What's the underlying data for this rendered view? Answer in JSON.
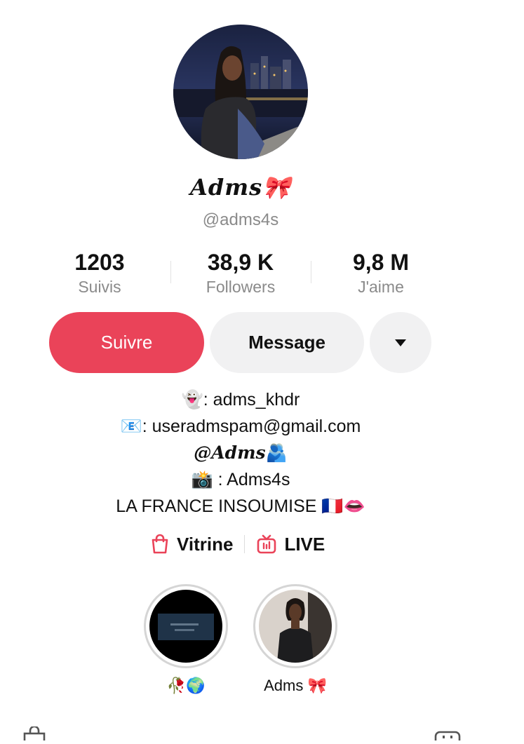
{
  "profile": {
    "display_name": "Adms🎀",
    "handle": "@adms4s"
  },
  "stats": [
    {
      "value": "1203",
      "label": "Suivis"
    },
    {
      "value": "38,9 K",
      "label": "Followers"
    },
    {
      "value": "9,8 M",
      "label": "J'aime"
    }
  ],
  "actions": {
    "follow_label": "Suivre",
    "message_label": "Message"
  },
  "bio": {
    "line1_emoji": "👻",
    "line1_text": ": adms_khdr",
    "line2_emoji": "📧",
    "line2_text": ": useradmspam@gmail.com",
    "line3_text": "@Adms",
    "line3_emoji": "🫂",
    "line4_emoji": "📸",
    "line4_text": " : Adms4s",
    "line5_text": "LA FRANCE INSOUMISE ",
    "line5_emoji": "🇫🇷👄"
  },
  "links": {
    "showcase_label": "Vitrine",
    "live_label": "LIVE"
  },
  "highlights": [
    {
      "label": "🥀🌍"
    },
    {
      "label": "Adms 🎀"
    }
  ],
  "colors": {
    "accent": "#ea4359",
    "secondary_button": "#f1f1f2",
    "muted_text": "#8a8a8a"
  },
  "icons": {
    "showcase": "shopping-bag-icon",
    "live": "tv-icon",
    "more": "caret-down-icon"
  }
}
